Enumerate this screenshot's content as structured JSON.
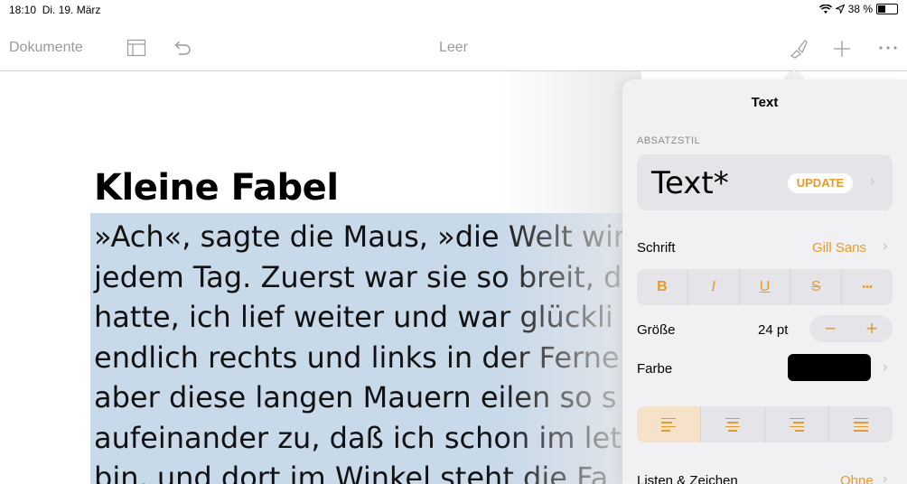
{
  "status": {
    "time": "18:10",
    "date": "Di. 19. März",
    "battery_text": "38 %",
    "battery_level": 0.38
  },
  "toolbar": {
    "documents_label": "Dokumente",
    "title": "Leer"
  },
  "document": {
    "title": "Kleine Fabel",
    "body": "»Ach«, sagte die Maus, »die Welt wir\njedem Tag. Zuerst war sie so breit, d\nhatte, ich lief weiter und war glückli\nendlich rechts und links in der Ferne\naber diese langen Mauern eilen so s\naufeinander zu, daß ich schon im let\nbin, und dort im Winkel steht die Fa"
  },
  "panel": {
    "title": "Text",
    "paragraph_style_label": "ABSATZSTIL",
    "paragraph_style_name": "Text*",
    "update_label": "UPDATE",
    "font_label": "Schrift",
    "font_value": "Gill Sans",
    "style_buttons": [
      "B",
      "I",
      "U",
      "S",
      "•••"
    ],
    "size_label": "Größe",
    "size_value": "24 pt",
    "color_label": "Farbe",
    "color_value": "#000000",
    "accent": "#e69a2e",
    "lists_label": "Listen & Zeichen",
    "lists_value": "Ohne"
  }
}
